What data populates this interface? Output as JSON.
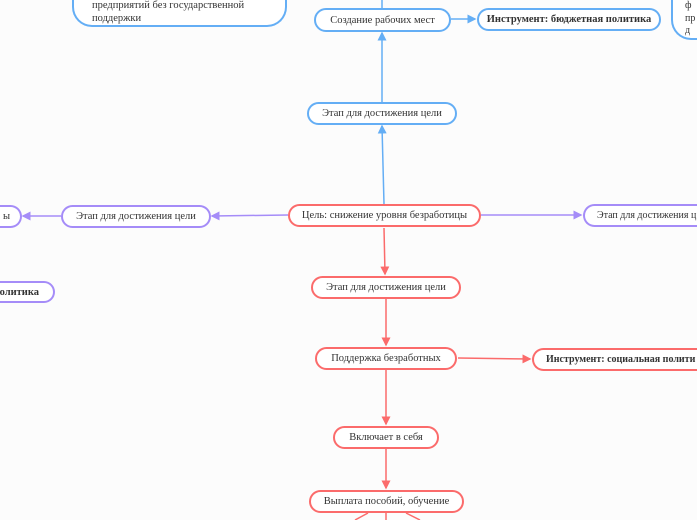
{
  "colors": {
    "blue": "#64aef5",
    "purple": "#a58cf8",
    "red": "#fb6b6b"
  },
  "nodes": {
    "top_left_note": [
      "предприятий без государственной",
      "поддержки"
    ],
    "job_creation": "Создание рабочих мест",
    "budget_tool": "Инструмент: бюджетная политика",
    "top_right_note": [
      "ф",
      "пр",
      "д"
    ],
    "stage_up": "Этап для достижения цели",
    "goal": "Цель: снижение уровня безработицы",
    "stage_left": "Этап для достижения цели",
    "far_left": "ы",
    "far_left_tool": "олитика",
    "stage_right": "Этап для достижения ц",
    "stage_down": "Этап для достижения цели",
    "support": "Поддержка безработных",
    "social_tool": "Инструмент: социальная полити",
    "includes": "Включает в себя",
    "payments": "Выплата пособий, обучение"
  }
}
